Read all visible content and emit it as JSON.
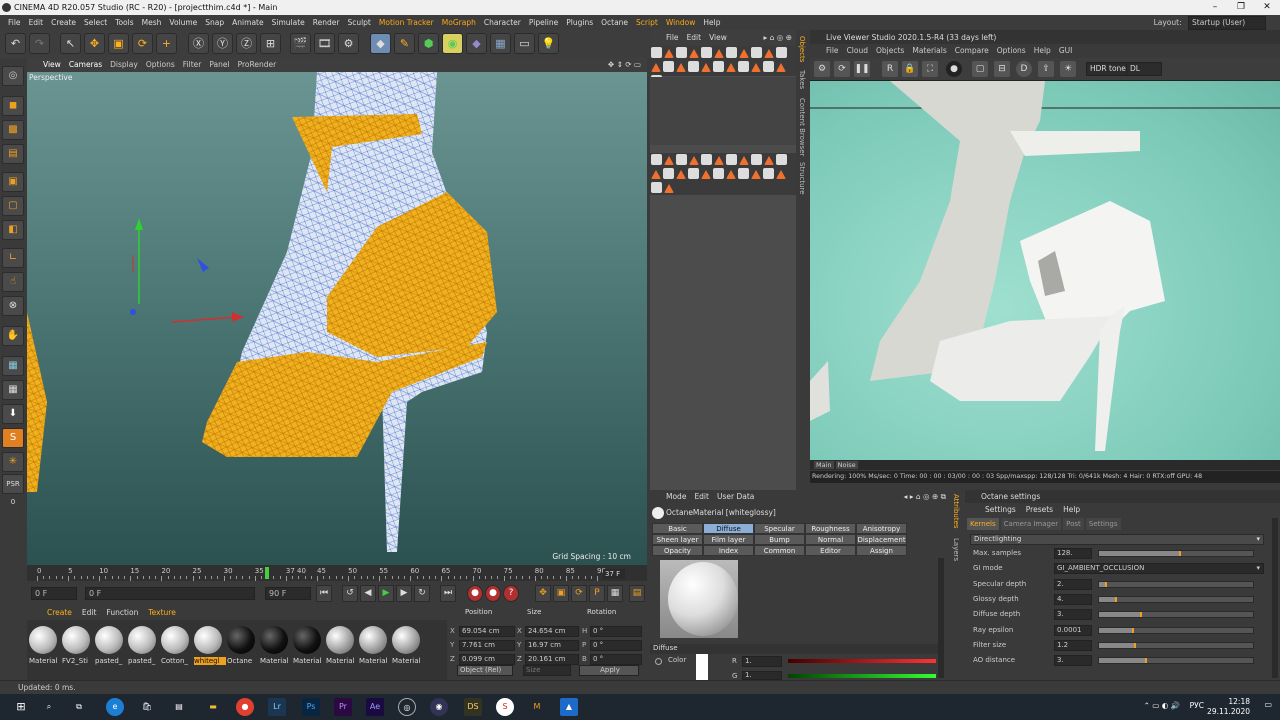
{
  "window": {
    "title": "CINEMA 4D R20.057 Studio (RC - R20) - [projectthim.c4d *] - Main"
  },
  "menubar": {
    "items": [
      "File",
      "Edit",
      "Create",
      "Select",
      "Tools",
      "Mesh",
      "Volume",
      "Snap",
      "Animate",
      "Simulate",
      "Render",
      "Sculpt",
      "Motion Tracker",
      "MoGraph",
      "Character",
      "Pipeline",
      "Plugins",
      "Octane",
      "Script",
      "Window",
      "Help"
    ],
    "highlighted": [
      "Motion Tracker",
      "MoGraph",
      "Script",
      "Window"
    ],
    "layout_label": "Layout:",
    "layout_value": "Startup (User)"
  },
  "viewport": {
    "menu": [
      "View",
      "Cameras",
      "Display",
      "Options",
      "Filter",
      "Panel",
      "ProRender"
    ],
    "label": "Perspective",
    "grid_spacing": "Grid Spacing : 10 cm"
  },
  "timeline": {
    "ticks": [
      "0",
      "5",
      "10",
      "15",
      "20",
      "25",
      "30",
      "35",
      "37 40",
      "45",
      "50",
      "55",
      "60",
      "65",
      "70",
      "75",
      "80",
      "85",
      "90"
    ],
    "frame_end": "37 F",
    "current_frame": 37,
    "max_frame": 90
  },
  "transport": {
    "start": "0 F",
    "min_field": "0 F",
    "max_field": "90 F",
    "end": "90 F"
  },
  "material_manager": {
    "menu": [
      "Create",
      "Edit",
      "Function",
      "Texture"
    ],
    "materials": [
      {
        "label": "Material",
        "style": "white"
      },
      {
        "label": "FV2_Sti",
        "style": "white"
      },
      {
        "label": "pasted_",
        "style": "white"
      },
      {
        "label": "pasted_",
        "style": "white"
      },
      {
        "label": "Cotton_",
        "style": "white"
      },
      {
        "label": "whitegl",
        "style": "white",
        "selected": true
      },
      {
        "label": "Octane",
        "style": "dark"
      },
      {
        "label": "Material",
        "style": "dark"
      },
      {
        "label": "Material",
        "style": "dark"
      },
      {
        "label": "Material",
        "style": "chk"
      },
      {
        "label": "Material",
        "style": "chk"
      },
      {
        "label": "Material",
        "style": "chk"
      }
    ]
  },
  "coords": {
    "headers": [
      "Position",
      "Size",
      "Rotation"
    ],
    "rows": [
      {
        "axis": "X",
        "pos": "69.054 cm",
        "size_axis": "X",
        "size": "24.654 cm",
        "rot_axis": "H",
        "rot": "0 °"
      },
      {
        "axis": "Y",
        "pos": "7.761 cm",
        "size_axis": "Y",
        "size": "16.97 cm",
        "rot_axis": "P",
        "rot": "0 °"
      },
      {
        "axis": "Z",
        "pos": "0.099 cm",
        "size_axis": "Z",
        "size": "20.161 cm",
        "rot_axis": "B",
        "rot": "0 °"
      }
    ],
    "mode": "Object (Rel)",
    "size_mode": "Size",
    "apply": "Apply"
  },
  "status": "Updated: 0 ms.",
  "object_manager": {
    "menu": [
      "File",
      "Edit",
      "View"
    ],
    "side_tabs": [
      "Objects",
      "Takes",
      "Content Browser",
      "Structure"
    ]
  },
  "live_viewer": {
    "title": "Live Viewer Studio 2020.1.5-R4 (33 days left)",
    "menu": [
      "File",
      "Cloud",
      "Objects",
      "Materials",
      "Compare",
      "Options",
      "Help",
      "GUI"
    ],
    "tonemap": "HDR tone",
    "dl": "DL",
    "tabs": [
      "Main",
      "Noise"
    ],
    "stats": "Rendering: 100%  Ms/sec: 0    Time: 00 : 00 : 03/00 : 00 : 03   Spp/maxspp: 128/128   Tri: 0/641k   Mesh: 4   Hair: 0    RTX:off    GPU:   48"
  },
  "attributes": {
    "menu": [
      "Mode",
      "Edit",
      "User Data"
    ],
    "material_title": "OctaneMaterial [whiteglossy]",
    "channel_tabs": [
      [
        "Basic",
        "Diffuse",
        "Specular",
        "Roughness",
        "Anisotropy"
      ],
      [
        "Sheen layer",
        "Film layer",
        "Bump",
        "Normal",
        "Displacement"
      ],
      [
        "Opacity",
        "Index",
        "Common",
        "Editor",
        "Assign"
      ]
    ],
    "selected_tab": "Diffuse",
    "diffuse_header": "Diffuse",
    "color_label": "Color",
    "r_label": "R",
    "r_value": "1.",
    "g_label": "G",
    "g_value": "1."
  },
  "octane_settings": {
    "title": "Octane settings",
    "menu": [
      "Settings",
      "Presets",
      "Help"
    ],
    "tabs": [
      "Kernels",
      "Camera Imager",
      "Post",
      "Settings"
    ],
    "kernel": "Directlighting",
    "rows": [
      {
        "label": "Max. samples",
        "value": "128.",
        "fill": 0.53
      },
      {
        "label": "GI mode",
        "value": "GI_AMBIENT_OCCLUSION",
        "dropdown": true
      },
      {
        "label": "Specular depth",
        "value": "2.",
        "fill": 0.05
      },
      {
        "label": "Glossy depth",
        "value": "4.",
        "fill": 0.12
      },
      {
        "label": "Diffuse depth",
        "value": "3.",
        "fill": 0.28
      },
      {
        "label": "Ray epsilon",
        "value": "0.0001",
        "fill": 0.23
      },
      {
        "label": "Filter size",
        "value": "1.2",
        "fill": 0.24
      },
      {
        "label": "AO distance",
        "value": "3.",
        "fill": 0.31
      }
    ]
  },
  "taskbar": {
    "lang": "РУС",
    "time": "12:18",
    "date": "29.11.2020"
  }
}
